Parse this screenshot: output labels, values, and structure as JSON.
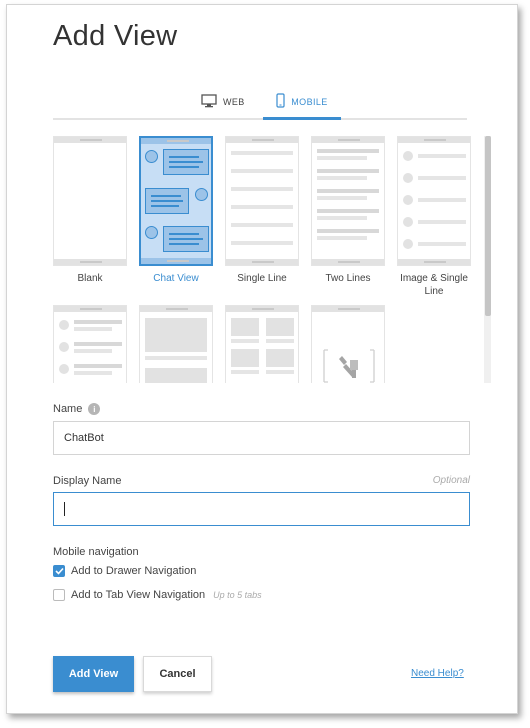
{
  "dialog": {
    "title": "Add View"
  },
  "tabs": [
    {
      "label": "WEB",
      "icon": "monitor-icon",
      "active": false
    },
    {
      "label": "MOBILE",
      "icon": "mobile-phone-icon",
      "active": true
    }
  ],
  "templates": [
    {
      "label": "Blank",
      "selected": false
    },
    {
      "label": "Chat View",
      "selected": true
    },
    {
      "label": "Single Line",
      "selected": false
    },
    {
      "label": "Two Lines",
      "selected": false
    },
    {
      "label": "Image & Single Line",
      "selected": false
    },
    {
      "label": "",
      "selected": false
    },
    {
      "label": "",
      "selected": false
    },
    {
      "label": "",
      "selected": false
    },
    {
      "label": "",
      "selected": false
    }
  ],
  "form": {
    "name_label": "Name",
    "name_value": "ChatBot",
    "display_name_label": "Display Name",
    "display_name_optional": "Optional",
    "display_name_value": "",
    "mobile_nav_label": "Mobile navigation",
    "drawer_nav_label": "Add to Drawer Navigation",
    "drawer_nav_checked": true,
    "tab_nav_label": "Add to Tab View Navigation",
    "tab_nav_hint": "Up to 5 tabs",
    "tab_nav_checked": false
  },
  "actions": {
    "add_view": "Add View",
    "cancel": "Cancel",
    "help": "Need Help?"
  },
  "colors": {
    "accent": "#3a8dd0",
    "selected_fill": "#c7def5"
  }
}
